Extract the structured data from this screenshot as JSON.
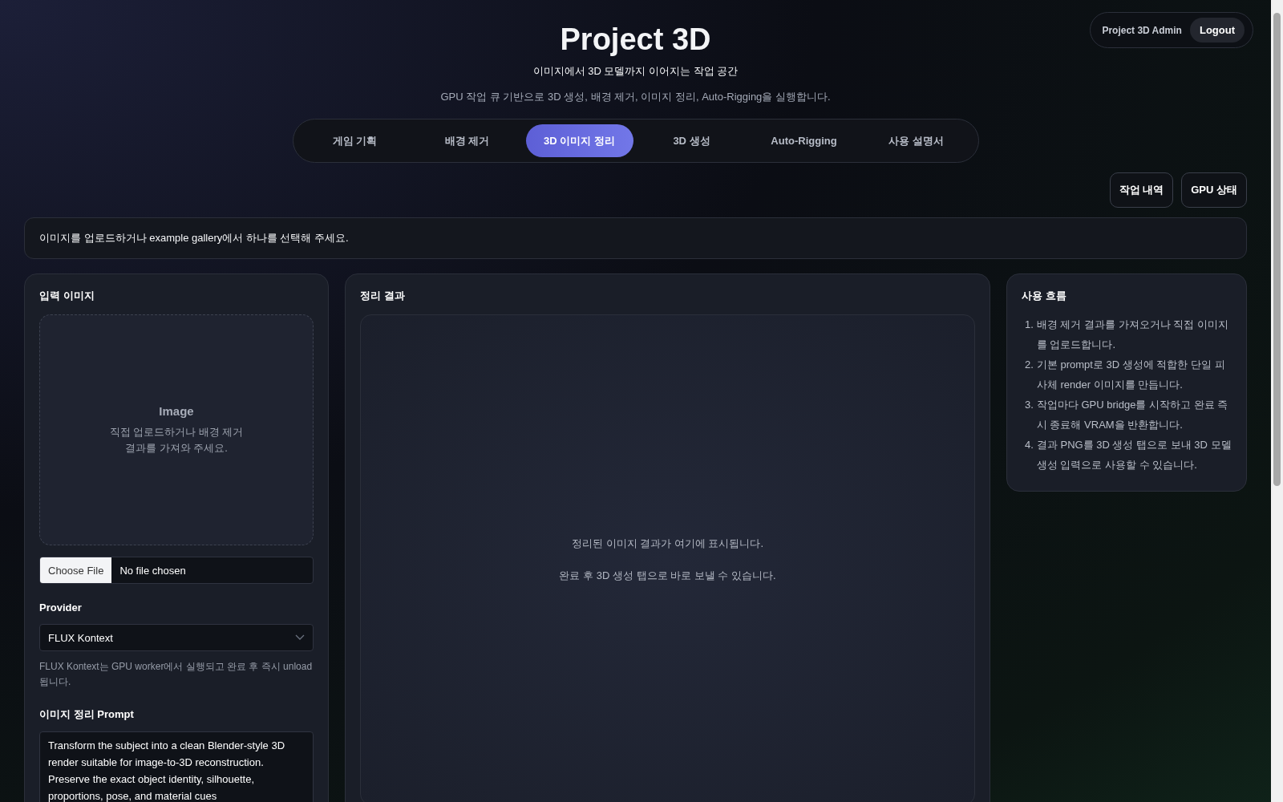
{
  "header": {
    "title": "Project 3D",
    "subtitle": "이미지에서 3D 모델까지 이어지는 작업 공간",
    "description": "GPU 작업 큐 기반으로 3D 생성, 배경 제거, 이미지 정리, Auto-Rigging을 실행합니다."
  },
  "account": {
    "user": "Project 3D Admin",
    "logout": "Logout"
  },
  "tabs": [
    {
      "label": "게임 기획",
      "selected": false
    },
    {
      "label": "배경 제거",
      "selected": false
    },
    {
      "label": "3D 이미지 정리",
      "selected": true
    },
    {
      "label": "3D 생성",
      "selected": false
    },
    {
      "label": "Auto-Rigging",
      "selected": false
    },
    {
      "label": "사용 설명서",
      "selected": false
    }
  ],
  "actions": [
    "작업 내역",
    "GPU 상태"
  ],
  "notice": "이미지를 업로드하거나 example gallery에서 하나를 선택해 주세요.",
  "input_panel": {
    "title": "입력 이미지",
    "dropzone": {
      "title": "Image",
      "hint": "직접 업로드하거나 배경 제거 결과를 가져와 주세요."
    },
    "file": {
      "button": "Choose File",
      "status": "No file chosen"
    },
    "provider": {
      "label": "Provider",
      "value": "FLUX Kontext",
      "help": "FLUX Kontext는 GPU worker에서 실행되고 완료 후 즉시 unload 됩니다."
    },
    "prompt": {
      "label": "이미지 정리 Prompt",
      "value": "Transform the subject into a clean Blender-style 3D render suitable for image-to-3D reconstruction. Preserve the exact object identity, silhouette, proportions, pose, and material cues"
    }
  },
  "result_panel": {
    "title": "정리 결과",
    "messages": [
      "정리된 이미지 결과가 여기에 표시됩니다.",
      "완료 후 3D 생성 탭으로 바로 보낼 수 있습니다."
    ]
  },
  "flow_panel": {
    "title": "사용 흐름",
    "steps": [
      {
        "marker": "1.",
        "text": "배경 제거 결과를 가져오거나 직접 이미지를 업로드합니다."
      },
      {
        "marker": "2.",
        "text": "기본 prompt로 3D 생성에 적합한 단일 피사체 render 이미지를 만듭니다."
      },
      {
        "marker": "3.",
        "text": "작업마다 GPU bridge를 시작하고 완료 즉시 종료해 VRAM을 반환합니다."
      },
      {
        "marker": "4.",
        "text": "결과 PNG를 3D 생성 탭으로 보내 3D 모델 생성 입력으로 사용할 수 있습니다."
      }
    ]
  }
}
